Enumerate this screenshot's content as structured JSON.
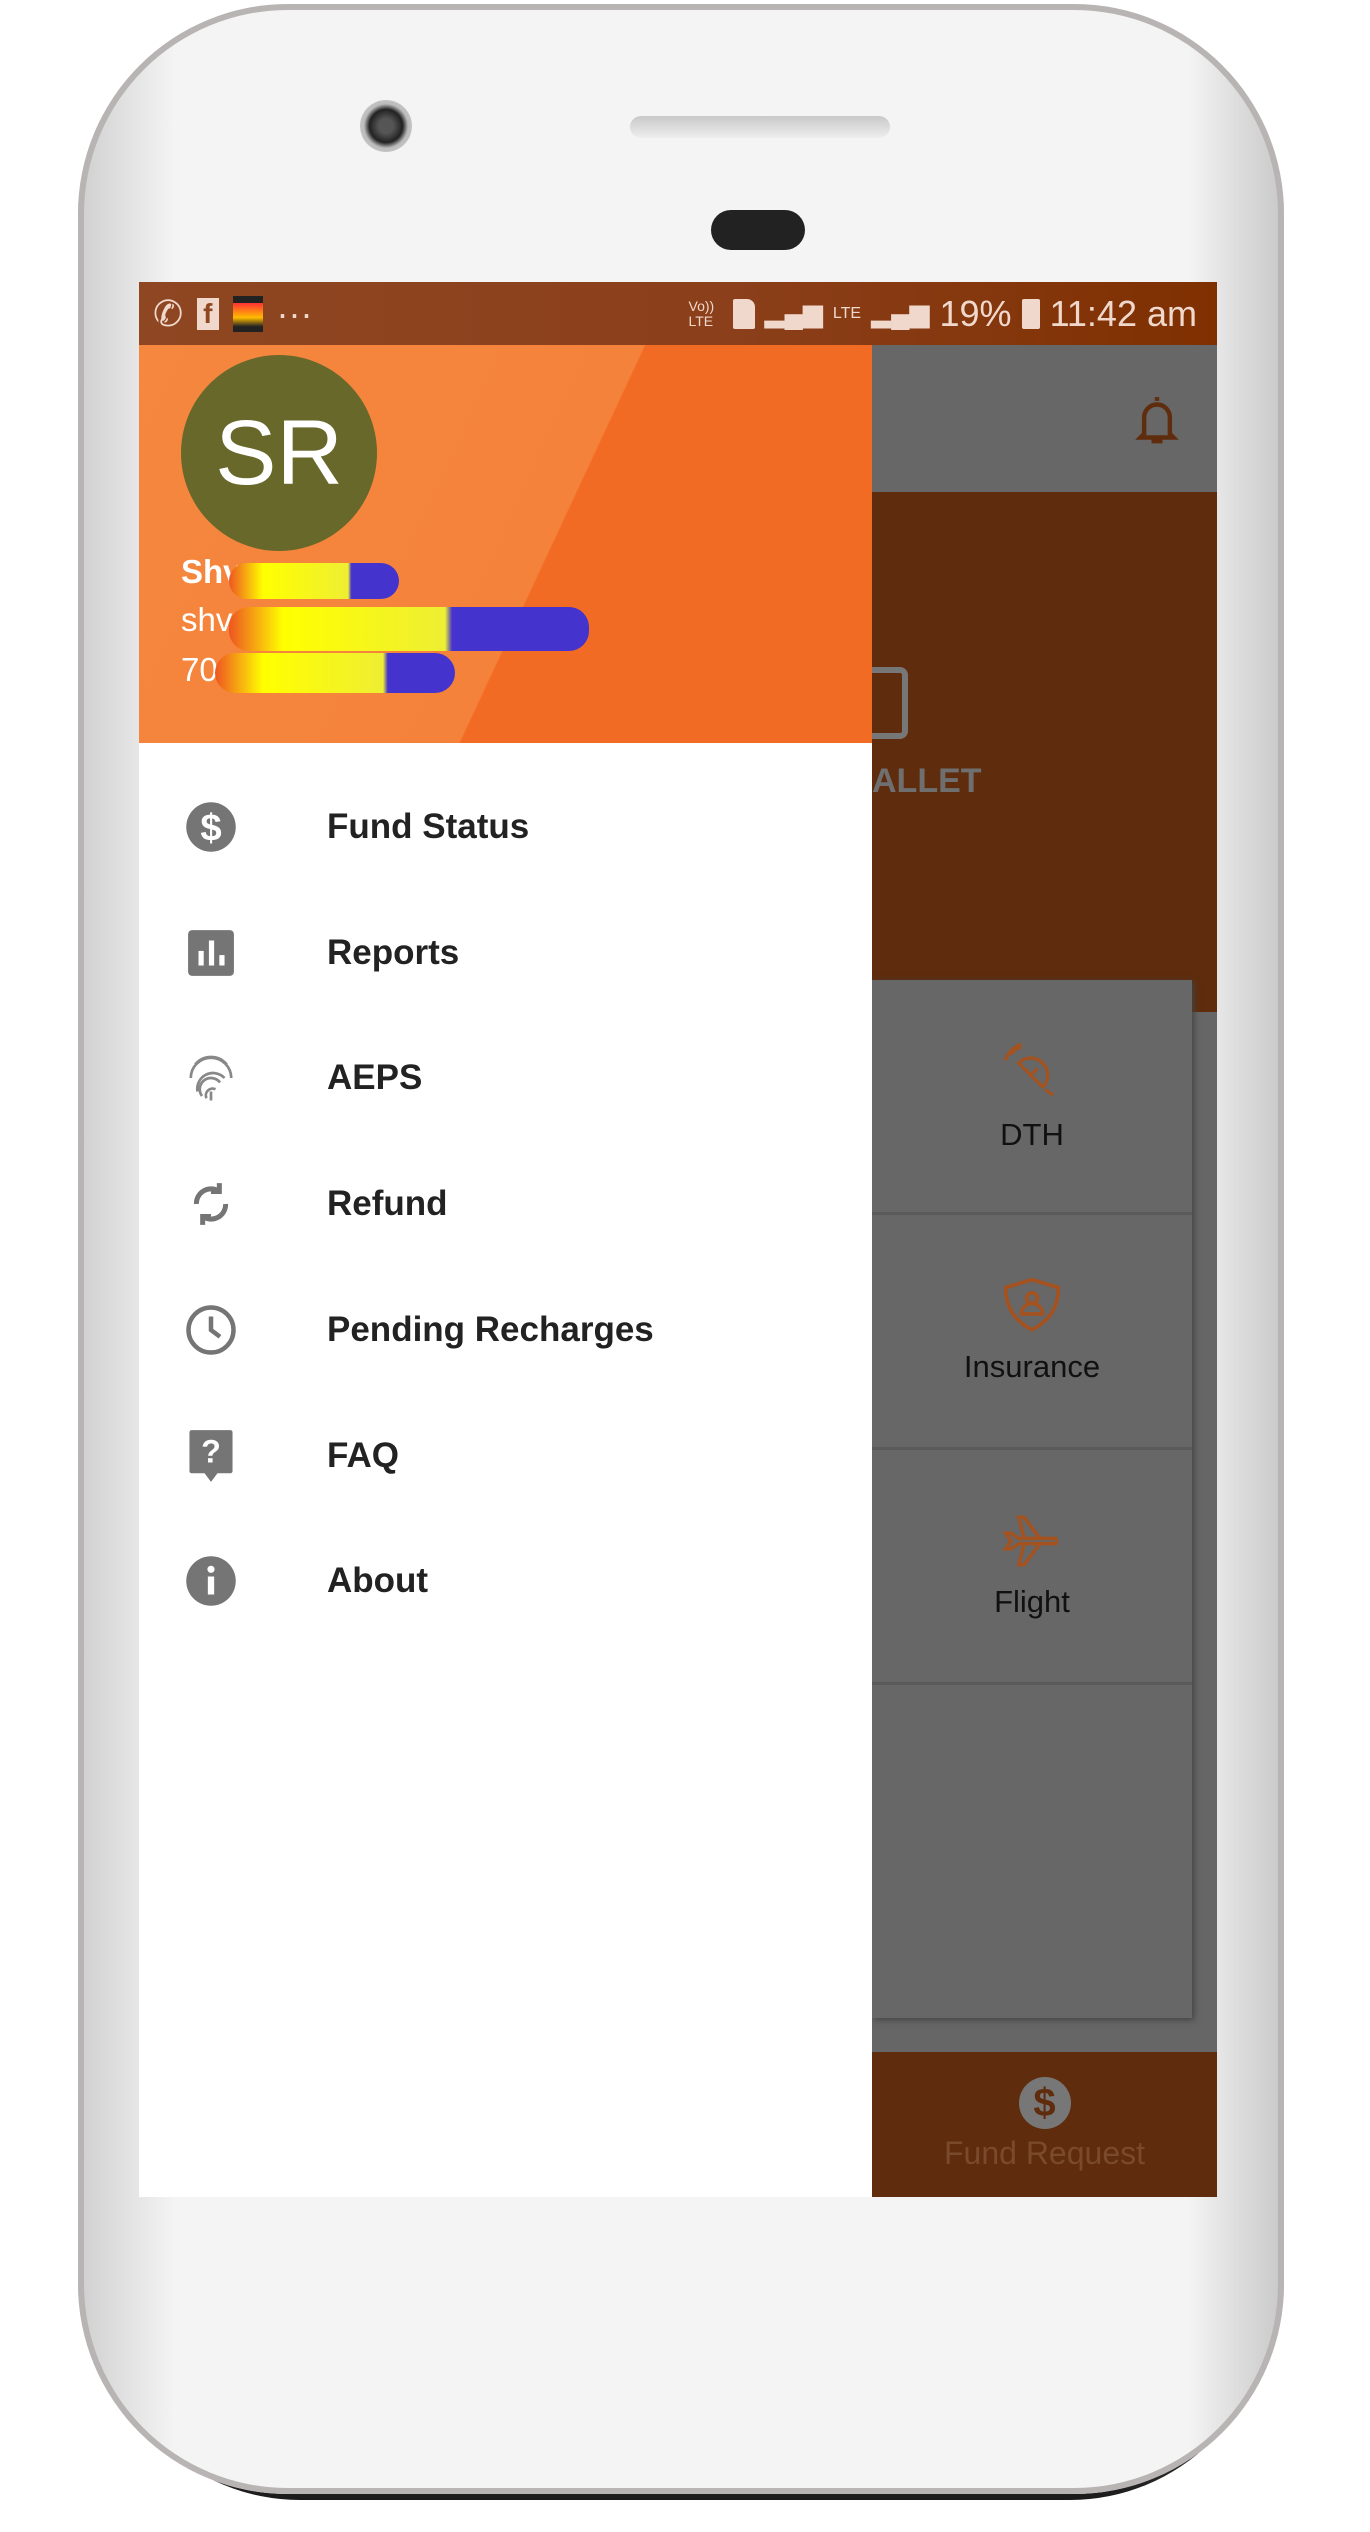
{
  "status_bar": {
    "battery": "19%",
    "time": "11:42 am",
    "network": "LTE",
    "volte": "Vo)) LTE",
    "app_icons": [
      "whatsapp-icon",
      "facebook-icon",
      "sonyliv-icon",
      "more-icon"
    ]
  },
  "drawer": {
    "avatar_initials": "SR",
    "user_name": "Shv",
    "user_email": "shv",
    "user_phone": "70",
    "items": [
      {
        "label": "Fund Status",
        "icon": "dollar-icon"
      },
      {
        "label": "Reports",
        "icon": "bar-chart-icon"
      },
      {
        "label": "AEPS",
        "icon": "fingerprint-icon"
      },
      {
        "label": "Refund",
        "icon": "refresh-icon"
      },
      {
        "label": "Pending Recharges",
        "icon": "clock-icon"
      },
      {
        "label": "FAQ",
        "icon": "question-icon"
      },
      {
        "label": "About",
        "icon": "info-icon"
      }
    ]
  },
  "background": {
    "wallet_label": "ALLET",
    "services": [
      {
        "label": "DTH",
        "icon": "satellite-dish-icon"
      },
      {
        "label": "Insurance",
        "icon": "shield-user-icon"
      },
      {
        "label": "Flight",
        "icon": "airplane-icon"
      }
    ],
    "bottom_nav": {
      "label": "Fund Request",
      "icon": "dollar-icon"
    }
  },
  "colors": {
    "accent": "#F26B25",
    "status_bar": "#8B3F1A",
    "avatar": "#67682A",
    "scrim_brown": "#5F2C0D"
  }
}
